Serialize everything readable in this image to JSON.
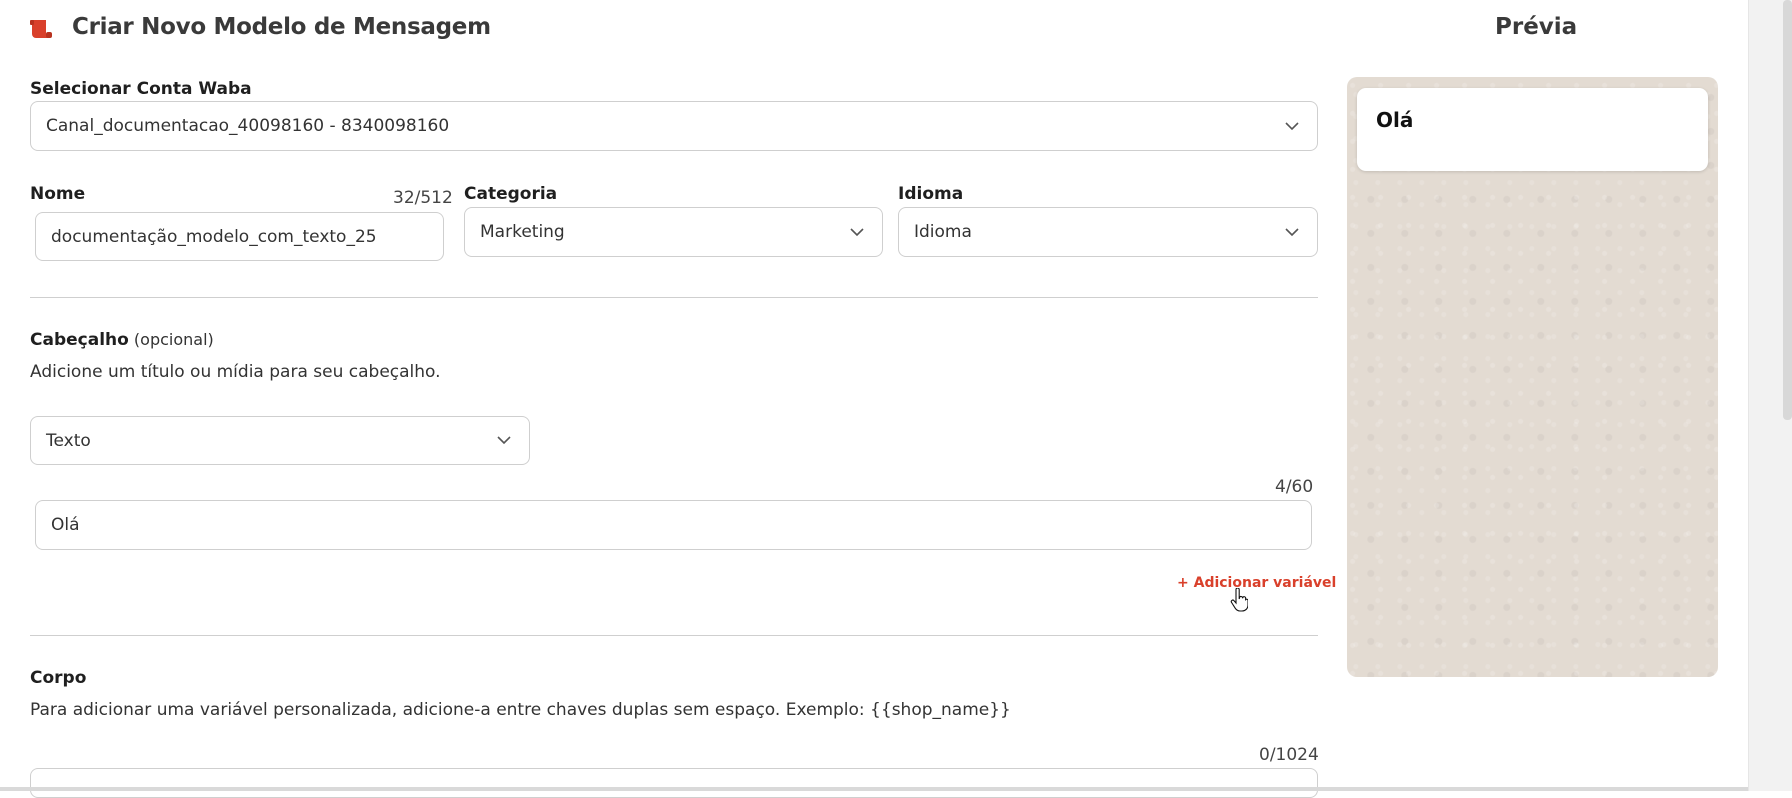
{
  "header": {
    "title": "Criar Novo Modelo de Mensagem",
    "logo_icon": "scroll-icon",
    "accent_color": "#d9402b"
  },
  "preview": {
    "title": "Prévia",
    "bubble_text": "Olá"
  },
  "waba": {
    "label": "Selecionar Conta Waba",
    "value": "Canal_documentacao_40098160 - 8340098160"
  },
  "name": {
    "label": "Nome",
    "counter": "32/512",
    "value": "documentação_modelo_com_texto_25"
  },
  "category": {
    "label": "Categoria",
    "value": "Marketing"
  },
  "language": {
    "label": "Idioma",
    "value": "Idioma"
  },
  "header_section": {
    "label": "Cabeçalho",
    "optional": "(opcional)",
    "description": "Adicione um título ou mídia para seu cabeçalho.",
    "type_value": "Texto",
    "counter": "4/60",
    "text_value": "Olá",
    "add_variable": "+ Adicionar variável"
  },
  "body_section": {
    "label": "Corpo",
    "description": "Para adicionar uma variável personalizada, adicione-a entre chaves duplas sem espaço. Exemplo: {{shop_name}}",
    "counter": "0/1024"
  }
}
